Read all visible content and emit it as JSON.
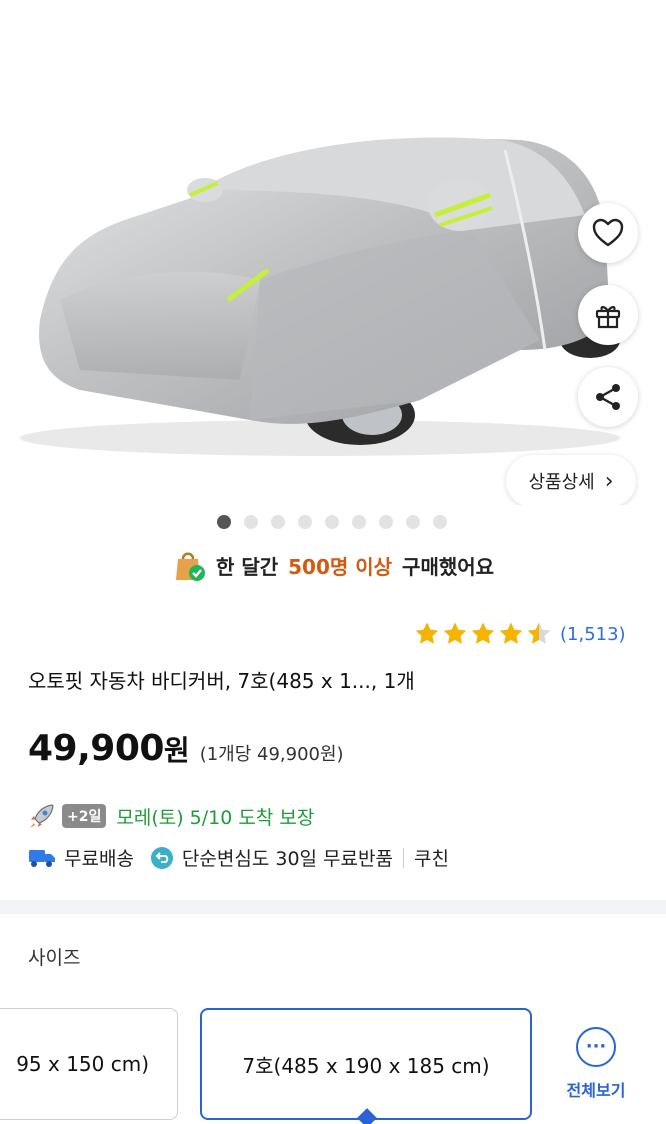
{
  "product_image": {
    "alt": "car-cover-image"
  },
  "actions": {
    "detail_label": "상품상세",
    "detail_chevron": "›"
  },
  "gallery": {
    "count": 9,
    "active_index": 0
  },
  "purchase_stat": {
    "prefix": "한 달간",
    "highlight": "500명 이상",
    "suffix": "구매했어요"
  },
  "rating": {
    "stars": 4.5,
    "count_text": "(1,513)"
  },
  "product": {
    "title": "오토핏 자동차 바디커버, 7호(485 x 1..., 1개",
    "price_number": "49,900",
    "price_won": "원",
    "unit_price": "(1개당 49,900원)"
  },
  "delivery": {
    "badge": "+2일",
    "text": "모레(토) 5/10 도착 보장"
  },
  "perks": {
    "free_shipping": "무료배송",
    "free_return": "단순변심도 30일 무료반품",
    "coupon": "쿠친"
  },
  "options": {
    "label": "사이즈",
    "prev_option": "95 x 150 cm)",
    "selected_option": "7호(485 x 190 x 185 cm)",
    "view_all": "전체보기",
    "view_all_icon": "···"
  },
  "colors": {
    "accent_blue": "#2a63d8",
    "highlight_orange": "#d25a12",
    "delivery_green": "#1e9e3a",
    "star_gold": "#f5b400"
  }
}
